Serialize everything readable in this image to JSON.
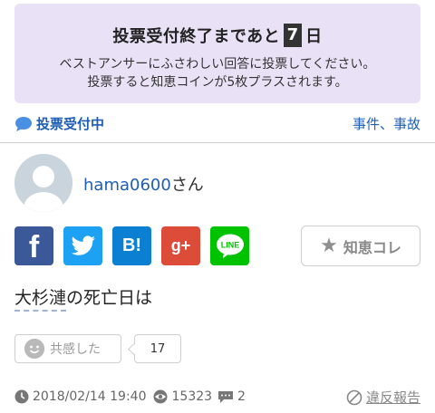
{
  "banner": {
    "title_before": "投票受付終了まであと",
    "days": "7",
    "title_after": "日",
    "line1": "ベストアンサーにふさわしい回答に投票してください。",
    "line2": "投票すると知恵コインが5枚プラスされます。"
  },
  "status": {
    "label": "投票受付中",
    "category": "事件、事故"
  },
  "user": {
    "name": "hama0600",
    "suffix": "さん"
  },
  "share": {
    "facebook_glyph": "f",
    "hatena_glyph": "B!",
    "googleplus_glyph": "g+",
    "line_glyph": "LINE"
  },
  "chiekore": {
    "label": "知恵コレ"
  },
  "question": {
    "keyword": "大杉漣",
    "rest": "の死亡日は"
  },
  "empathy": {
    "label": "共感した",
    "count": "17"
  },
  "meta": {
    "datetime": "2018/02/14 19:40",
    "views": "15323",
    "answers": "2",
    "report_label": "違反報告"
  },
  "colors": {
    "banner_bg": "#e9e2f7",
    "link_blue": "#1e5fb5",
    "facebook": "#3b5998",
    "twitter": "#1da1f2",
    "hatena": "#0b7fd1",
    "googleplus": "#dd4b39",
    "line": "#00c300"
  }
}
